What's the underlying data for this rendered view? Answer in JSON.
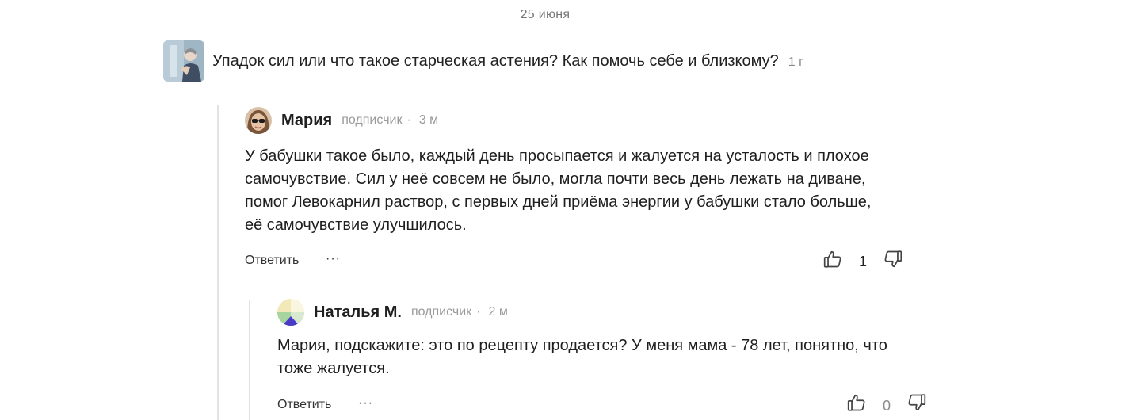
{
  "date_label": "25 июня",
  "article": {
    "title": "Упадок сил или что такое старческая астения? Как помочь себе и близкому?",
    "age": "1 г",
    "thumb_icon": "article-thumbnail-image"
  },
  "comments": [
    {
      "author": "Мария",
      "role": "подписчик",
      "separator": "·",
      "age": "3 м",
      "avatar_icon": "user-photo-avatar",
      "text_lines": [
        "У бабушки такое было, каждый день просыпается и жалуется на усталость и плохое",
        "самочувствие. Сил у неё совсем не было, могла почти весь день лежать на диване,",
        "помог Левокарнил раствор, с первых дней приёма энергии у бабушки стало больше,",
        "её самочувствие улучшилось."
      ],
      "reply_label": "Ответить",
      "more_label": "···",
      "likes": "1",
      "colors": {
        "text": "#1f1f1f"
      }
    },
    {
      "author": "Наталья М.",
      "role": "подписчик",
      "separator": "·",
      "age": "2 м",
      "avatar_icon": "generated-avatar",
      "text_lines": [
        "Мария, подскажите: это по рецепту продается? У меня мама  - 78 лет, понятно, что",
        "тоже жалуется."
      ],
      "reply_label": "Ответить",
      "more_label": "···",
      "likes": "0",
      "colors": {
        "avatar_top": "#f3e9b8",
        "avatar_mid": "#a8d4a0",
        "avatar_bottom": "#4a3ac8"
      }
    }
  ]
}
